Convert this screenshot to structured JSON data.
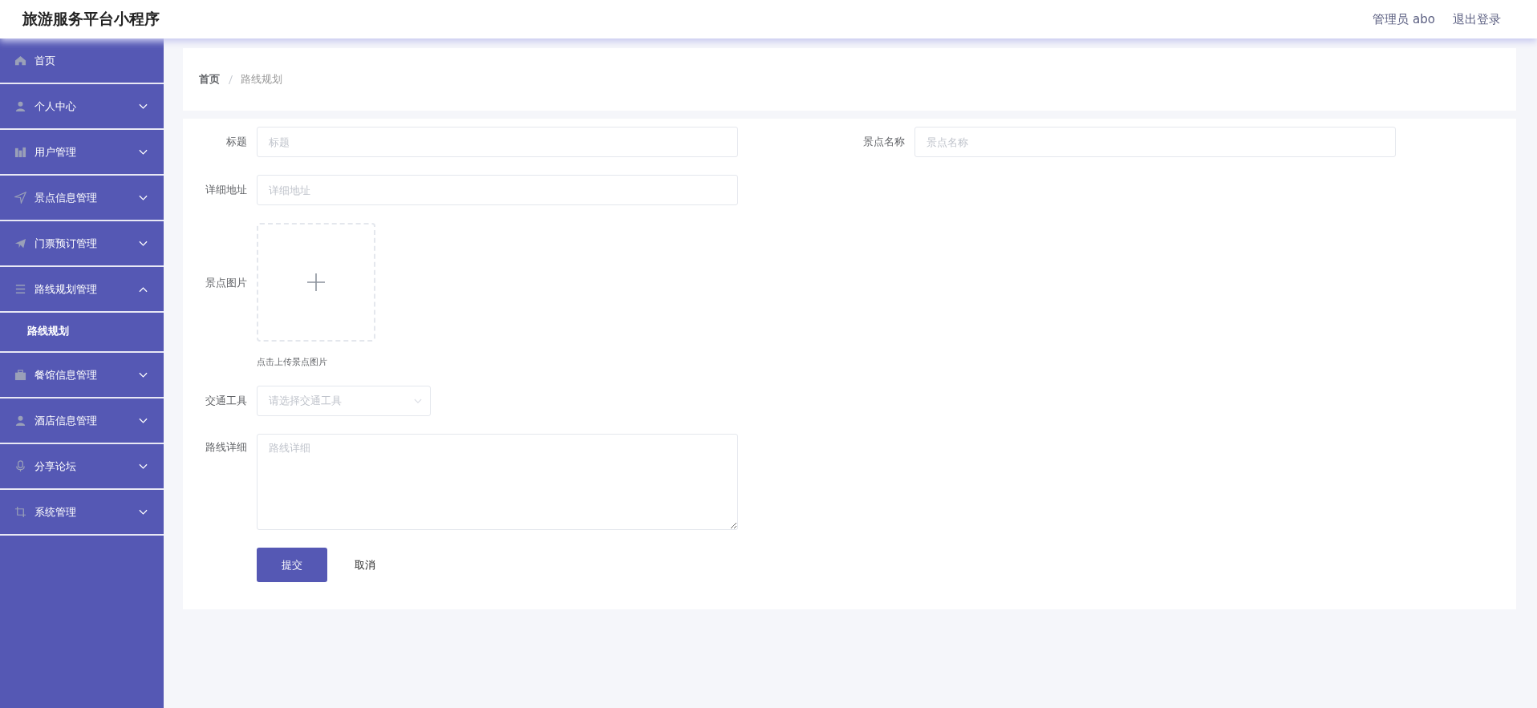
{
  "header": {
    "title": "旅游服务平台小程序",
    "user": "管理员 abo",
    "logout": "退出登录"
  },
  "sidebar": {
    "items": [
      {
        "label": "首页"
      },
      {
        "label": "个人中心",
        "expanded": false
      },
      {
        "label": "用户管理",
        "expanded": false
      },
      {
        "label": "景点信息管理",
        "expanded": false
      },
      {
        "label": "门票预订管理",
        "expanded": false
      },
      {
        "label": "路线规划管理",
        "expanded": true,
        "children": [
          {
            "label": "路线规划"
          }
        ]
      },
      {
        "label": "餐馆信息管理",
        "expanded": false
      },
      {
        "label": "酒店信息管理",
        "expanded": false
      },
      {
        "label": "分享论坛",
        "expanded": false
      },
      {
        "label": "系统管理",
        "expanded": false
      }
    ]
  },
  "breadcrumb": [
    "首页",
    "路线规划"
  ],
  "form": {
    "title": {
      "label": "标题",
      "placeholder": "标题"
    },
    "spot_name": {
      "label": "景点名称",
      "placeholder": "景点名称"
    },
    "address": {
      "label": "详细地址",
      "placeholder": "详细地址"
    },
    "image": {
      "label": "景点图片",
      "hint": "点击上传景点图片"
    },
    "transport": {
      "label": "交通工具",
      "placeholder": "请选择交通工具"
    },
    "route_detail": {
      "label": "路线详细",
      "placeholder": "路线详细"
    },
    "submit": "提交",
    "cancel": "取消"
  }
}
